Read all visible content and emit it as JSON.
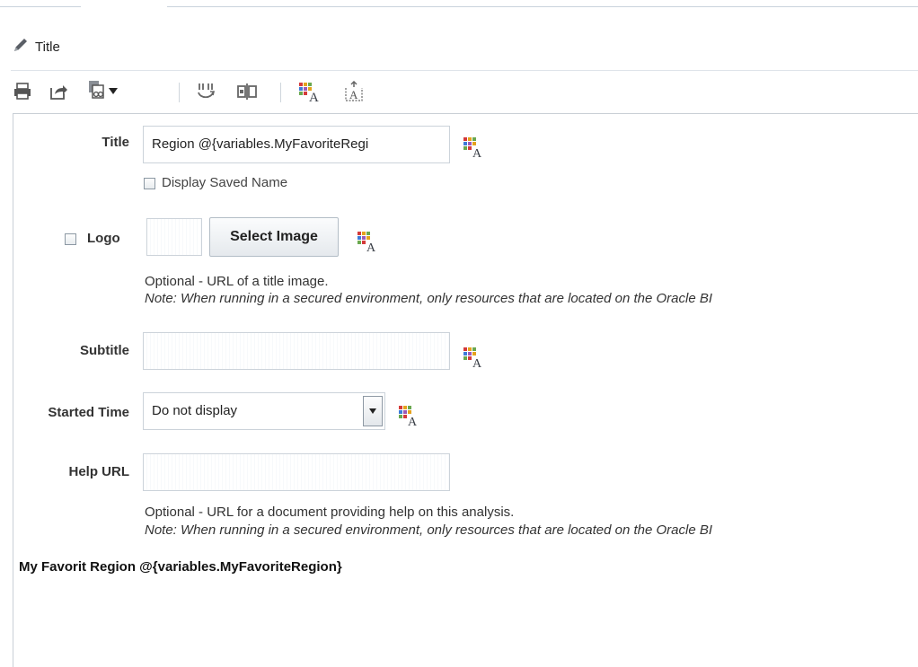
{
  "header": {
    "title": "Title"
  },
  "toolbar": {
    "icons": [
      "print-icon",
      "export-icon",
      "copy-icon",
      "merge-icon",
      "split-icon",
      "format-icon",
      "insert-text-icon"
    ]
  },
  "form": {
    "title": {
      "label": "Title",
      "value": "Region @{variables.MyFavoriteRegi"
    },
    "display_saved_name": {
      "label": "Display Saved Name",
      "checked": false
    },
    "logo": {
      "label": "Logo",
      "checked": false,
      "button": "Select Image"
    },
    "logo_help": {
      "line1": "Optional - URL of a title image.",
      "line2": "Note: When running in a secured environment, only resources that are located on the Oracle BI "
    },
    "subtitle": {
      "label": "Subtitle",
      "value": ""
    },
    "started_time": {
      "label": "Started Time",
      "value": "Do not display"
    },
    "help_url": {
      "label": "Help URL",
      "value": ""
    },
    "help_url_help": {
      "line1": "Optional - URL for a document providing help on this analysis.",
      "line2": "Note: When running in a secured environment, only resources that are located on the Oracle BI "
    }
  },
  "preview": {
    "text": "My Favorit Region @{variables.MyFavoriteRegion}"
  },
  "colors": {
    "border": "#ccd3da",
    "accent": "#2e6da4",
    "text": "#333333"
  }
}
